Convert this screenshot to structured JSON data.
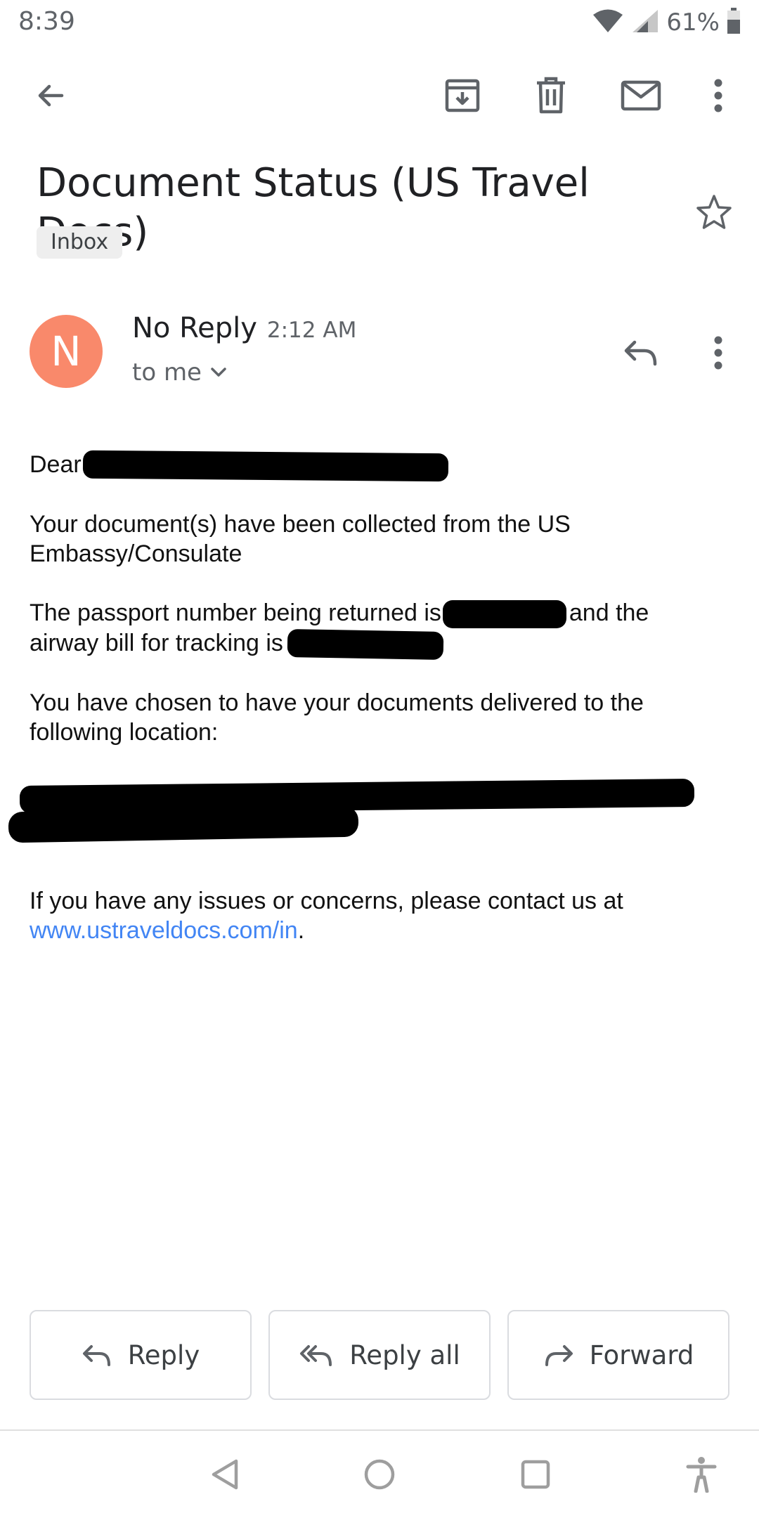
{
  "status_bar": {
    "time": "8:39",
    "battery_percent": "61%",
    "icons": [
      "wifi-icon",
      "cellular-signal-icon",
      "battery-icon"
    ]
  },
  "toolbar": {
    "icons": [
      "back-arrow-icon",
      "archive-icon",
      "delete-icon",
      "mark-unread-icon",
      "more-vert-icon"
    ]
  },
  "email": {
    "subject": "Document Status (US Travel Docs)",
    "label": "Inbox",
    "sender": {
      "avatar_letter": "N",
      "avatar_color": "#f9896b",
      "name": "No Reply",
      "time": "2:12 AM",
      "recipient": "to me"
    },
    "body": {
      "greeting": "Dear",
      "line1": "Your document(s) have been collected from the US Embassy/Consulate",
      "passport_prefix": "The passport number being returned is",
      "passport_suffix": "and the airway bill for tracking is",
      "delivery": "You have chosen to have your documents delivered to the following location:",
      "contact_prefix": "If you have any issues or concerns, please contact us at",
      "contact_link": "www.ustraveldocs.com/in",
      "contact_suffix": "."
    }
  },
  "actions": {
    "reply": "Reply",
    "reply_all": "Reply all",
    "forward": "Forward"
  },
  "nav": {
    "icons": [
      "nav-back-icon",
      "nav-home-icon",
      "nav-recents-icon",
      "accessibility-icon"
    ]
  },
  "colors": {
    "link": "#4285f4",
    "icon_gray": "#5f6368"
  }
}
